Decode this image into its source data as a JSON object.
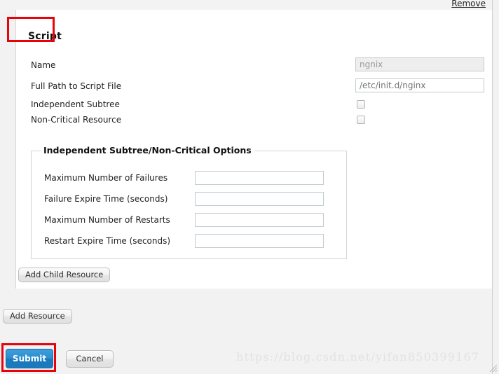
{
  "header": {
    "remove_label": "Remove"
  },
  "section": {
    "title": "Script"
  },
  "form": {
    "rows": [
      {
        "label": "Name",
        "value": "ngnix",
        "disabled": true
      },
      {
        "label": "Full Path to Script File",
        "value": "/etc/init.d/nginx",
        "disabled": false
      }
    ],
    "checkboxes": [
      {
        "label": "Independent Subtree",
        "checked": false
      },
      {
        "label": "Non-Critical Resource",
        "checked": false
      }
    ]
  },
  "options": {
    "legend": "Independent Subtree/Non-Critical Options",
    "fields": [
      {
        "label": "Maximum Number of Failures",
        "value": ""
      },
      {
        "label": "Failure Expire Time (seconds)",
        "value": ""
      },
      {
        "label": "Maximum Number of Restarts",
        "value": ""
      },
      {
        "label": "Restart Expire Time (seconds)",
        "value": ""
      }
    ]
  },
  "buttons": {
    "add_child_resource": "Add Child Resource",
    "add_resource": "Add Resource",
    "submit": "Submit",
    "cancel": "Cancel"
  },
  "watermark": {
    "text": "https://blog.csdn.net/yifan850399167"
  },
  "colors": {
    "highlight": "#e8030a",
    "submit_blue": "#1b79bd",
    "page_bg": "#f2f2f2",
    "panel_bg": "#ffffff"
  }
}
